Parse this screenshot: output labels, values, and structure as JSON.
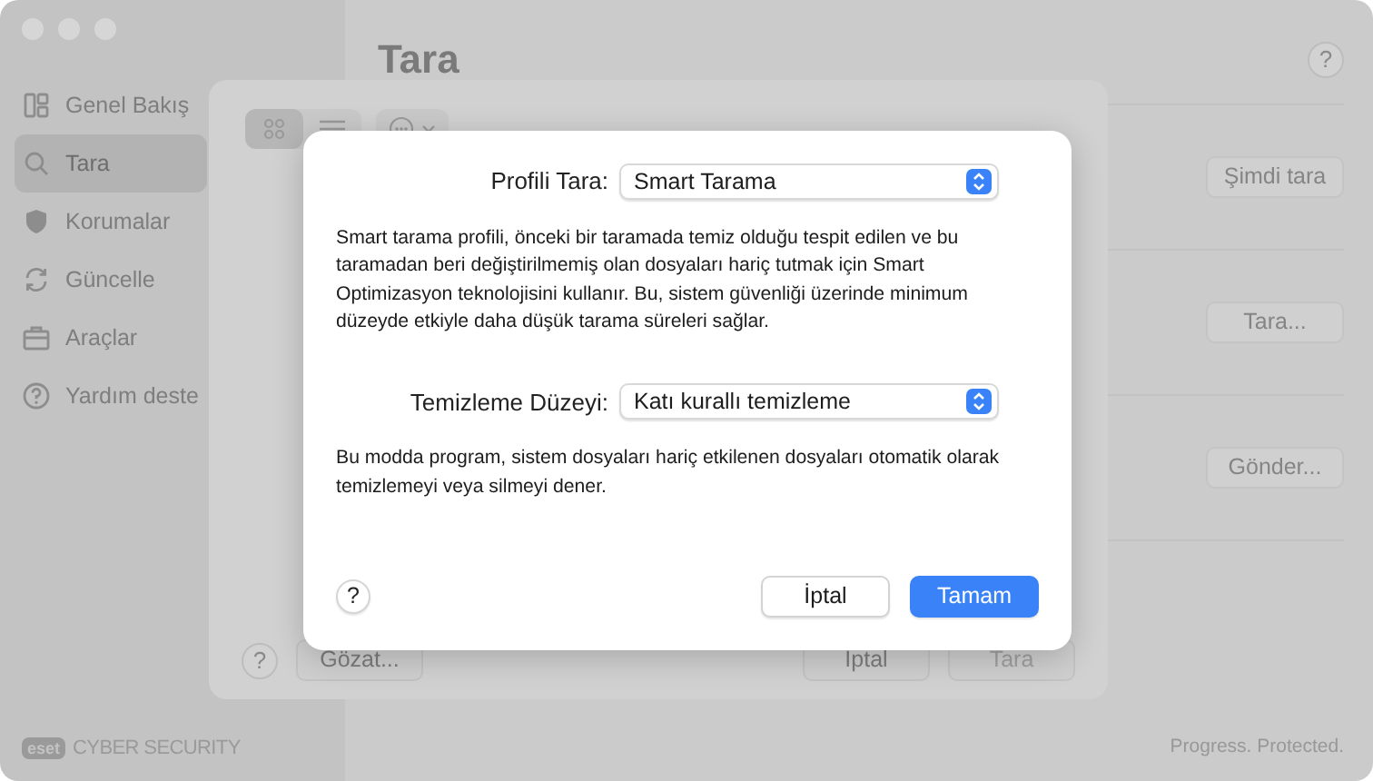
{
  "sidebar": {
    "items": [
      {
        "label": "Genel Bakış",
        "kind": "overview",
        "selected": false
      },
      {
        "label": "Tara",
        "kind": "search",
        "selected": true
      },
      {
        "label": "Korumalar",
        "kind": "shield",
        "selected": false
      },
      {
        "label": "Güncelle",
        "kind": "refresh",
        "selected": false
      },
      {
        "label": "Araçlar",
        "kind": "briefcase",
        "selected": false
      },
      {
        "label": "Yardım deste",
        "kind": "help",
        "selected": false
      }
    ],
    "brand": {
      "logo": "eset",
      "product": "CYBER SECURITY"
    }
  },
  "main": {
    "title": "Tara",
    "help": "?",
    "actions": [
      "Şimdi tara",
      "Tara...",
      "Gönder..."
    ],
    "footer": "Progress. Protected."
  },
  "sheet": {
    "view_modes": [
      {
        "kind": "grid",
        "selected": true
      },
      {
        "kind": "list",
        "selected": false
      }
    ],
    "help": "?",
    "buttons": [
      {
        "label": "Gözat...",
        "disabled": false
      },
      {
        "label": "İptal",
        "disabled": false
      },
      {
        "label": "Tara",
        "disabled": true
      }
    ]
  },
  "dialog": {
    "fields": [
      {
        "label": "Profili Tara:",
        "value": "Smart Tarama",
        "description": "Smart tarama profili, önceki bir taramada temiz olduğu tespit edilen ve bu taramadan beri değiştirilmemiş olan dosyaları hariç tutmak için Smart Optimizasyon teknolojisini kullanır. Bu, sistem güvenliği üzerinde minimum düzeyde etkiyle daha düşük tarama süreleri sağlar."
      },
      {
        "label": "Temizleme Düzeyi:",
        "value": "Katı kurallı temizleme",
        "description": "Bu modda program, sistem dosyaları hariç etkilenen dosyaları otomatik olarak temizlemeyi veya silmeyi dener."
      }
    ],
    "help": "?",
    "buttons": [
      {
        "label": "İptal",
        "default": false
      },
      {
        "label": "Tamam",
        "default": true
      }
    ]
  }
}
